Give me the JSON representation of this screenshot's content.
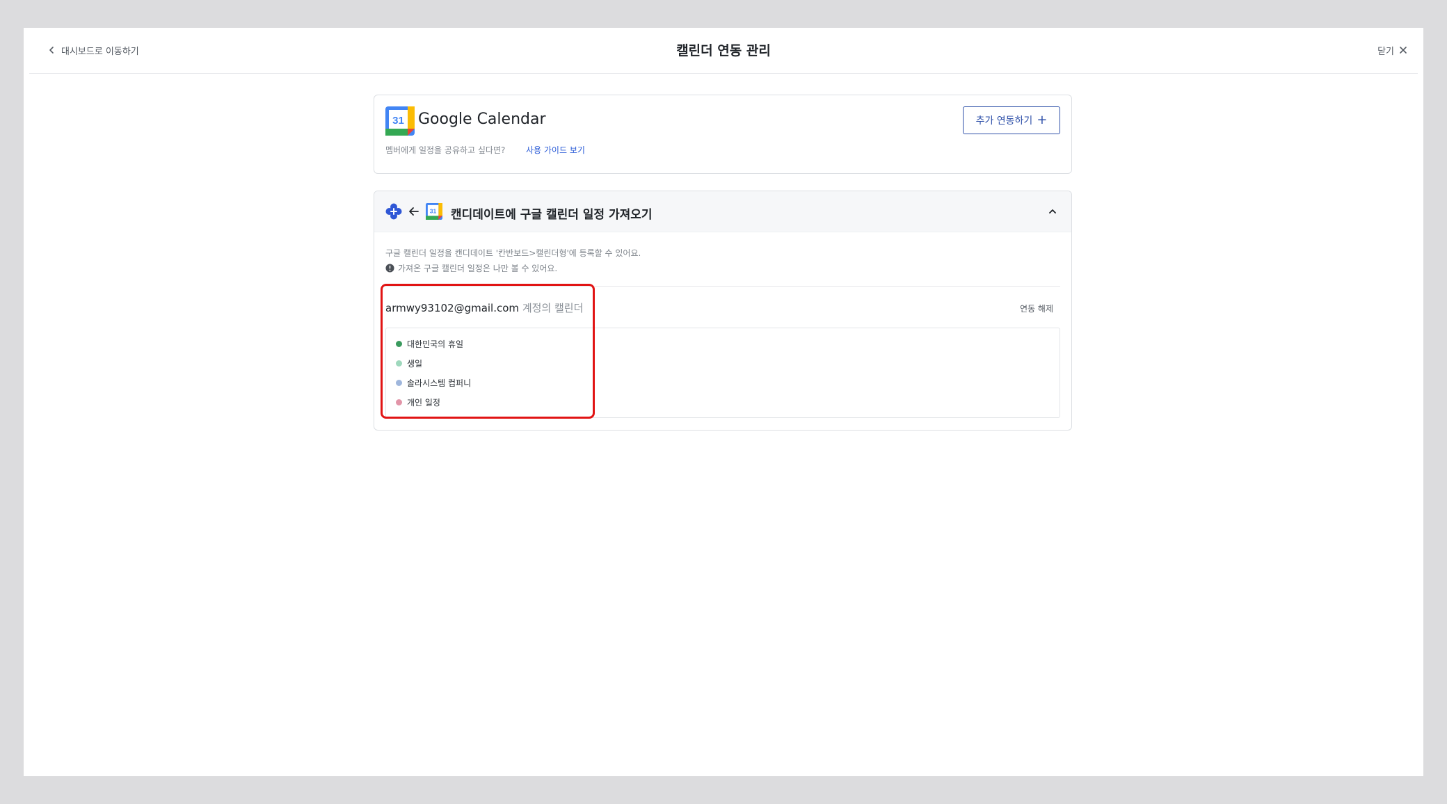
{
  "header": {
    "back_label": "대시보드로 이동하기",
    "title": "캘린더 연동 관리",
    "close_label": "닫기"
  },
  "google_card": {
    "logo_number": "31",
    "title": "Google Calendar",
    "share_text": "멤버에게 일정을 공유하고 싶다면?",
    "guide_link": "사용 가이드 보기",
    "add_button_label": "추가 연동하기"
  },
  "import_section": {
    "title": "캔디데이트에 구글 캘린더 일정 가져오기",
    "logo_number": "31",
    "description": "구글 캘린더 일정을 캔디데이트 '칸반보드>캘린더형'에 등록할 수 있어요.",
    "notice": "가져온 구글 캘린더 일정은 나만 볼 수 있어요.",
    "account": {
      "email": "armwy93102@gmail.com",
      "suffix": "계정의 캘린더",
      "unlink_label": "연동 해제"
    },
    "calendars": [
      {
        "name": "대한민국의 휴일",
        "color": "#3a9a5e"
      },
      {
        "name": "생일",
        "color": "#9fd8bd"
      },
      {
        "name": "솔라시스템 컴퍼니",
        "color": "#9fb6dc"
      },
      {
        "name": "개인 일정",
        "color": "#e295a8"
      }
    ]
  },
  "colors": {
    "accent": "#2d4fa8",
    "link": "#2a5bd7",
    "highlight": "#e11414"
  }
}
